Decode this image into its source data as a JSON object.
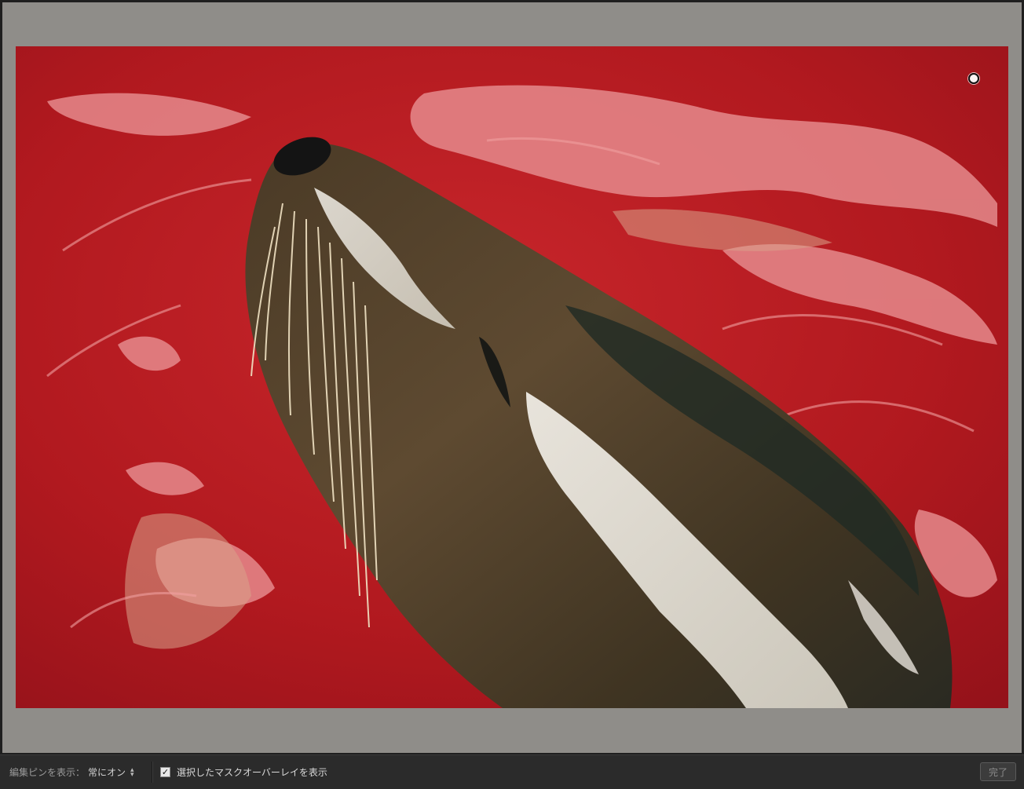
{
  "toolbar": {
    "pin_label": "編集ピンを表示：",
    "pin_value": "常にオン",
    "overlay_label": "選択したマスクオーバーレイを表示",
    "overlay_checked": true,
    "done_label": "完了"
  },
  "photo": {
    "overlay_color": "#b3161c",
    "background_color": "#8f8d89"
  },
  "icons": {
    "stepper": "up-down-arrows-icon",
    "checkbox_mark": "checkmark-icon",
    "pin": "edit-pin-icon"
  }
}
